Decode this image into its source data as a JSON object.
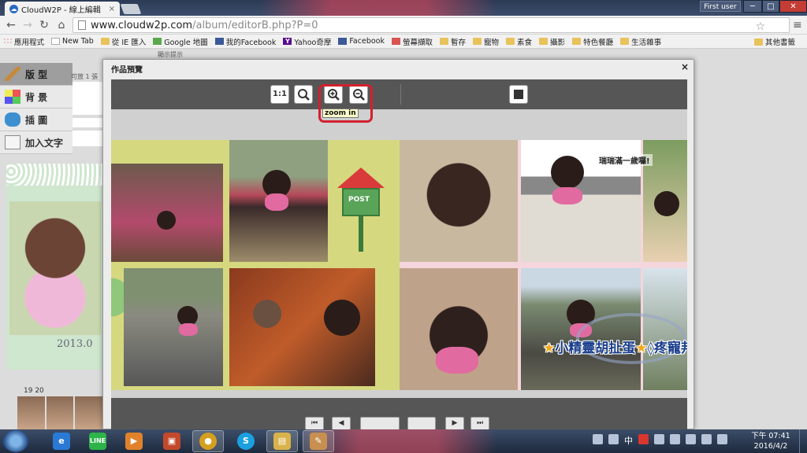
{
  "browser": {
    "tab_title": "CloudW2P - 線上編輯",
    "tab_close": "×",
    "user_badge": "First user",
    "window_controls": {
      "minimize": "─",
      "maximize": "□",
      "close": "✕"
    },
    "url_host": "www.cloudw2p.com",
    "url_path": "/album/editorB.php?P=0",
    "bookmarks": [
      {
        "label": "應用程式",
        "icon": "apps-icon"
      },
      {
        "label": "New Tab",
        "icon": "page-icon"
      },
      {
        "label": "從 IE 匯入",
        "icon": "folder-icon"
      },
      {
        "label": "Google 地圖",
        "icon": "google-maps-icon"
      },
      {
        "label": "我的Facebook",
        "icon": "facebook-icon"
      },
      {
        "label": "Yahoo奇摩",
        "icon": "yahoo-icon"
      },
      {
        "label": "Facebook",
        "icon": "facebook-icon"
      },
      {
        "label": "螢幕擷取",
        "icon": "home-icon"
      },
      {
        "label": "暫存",
        "icon": "folder-icon"
      },
      {
        "label": "寵物",
        "icon": "folder-icon"
      },
      {
        "label": "素食",
        "icon": "folder-icon"
      },
      {
        "label": "攝影",
        "icon": "folder-icon"
      },
      {
        "label": "特色餐廳",
        "icon": "folder-icon"
      },
      {
        "label": "生活雜事",
        "icon": "folder-icon"
      }
    ],
    "bookmarks_other": "其他書籤"
  },
  "editor": {
    "side_menu": [
      {
        "label": "版 型",
        "icon": "layout-icon"
      },
      {
        "label": "背 景",
        "icon": "background-icon"
      },
      {
        "label": "插 圖",
        "icon": "illustration-icon"
      },
      {
        "label": "加入文字",
        "icon": "text-icon"
      }
    ],
    "side_hint": "可放 1 張",
    "top_hint": "顯示提示",
    "card_date": "2013.0",
    "page_numbers": "19  20"
  },
  "dialog": {
    "title": "作品預覽",
    "close": "×",
    "toolbar": {
      "actual_size_label": "1:1",
      "zoom_in_tooltip": "zoom in"
    },
    "album": {
      "mailbox_label": "POST",
      "caption": "瑞瑞滿一歲囉!",
      "watermark": "小精靈胡扯蛋",
      "watermark_tail": "◊疼寵邦◊"
    },
    "highlight_color": "#d1202e"
  },
  "taskbar": {
    "apps": [
      {
        "name": "ie",
        "label": "e",
        "color": "#2a7ad5"
      },
      {
        "name": "line",
        "label": "LINE",
        "color": "#2db34a"
      },
      {
        "name": "media-player",
        "label": "▶",
        "color": "#e0822a"
      },
      {
        "name": "store",
        "label": "▣",
        "color": "#c2492c"
      },
      {
        "name": "chrome",
        "label": "●",
        "color": "#d4a020"
      },
      {
        "name": "skype",
        "label": "S",
        "color": "#1aa0e0"
      },
      {
        "name": "explorer",
        "label": "▤",
        "color": "#d9b24a"
      },
      {
        "name": "paint",
        "label": "✎",
        "color": "#c89050"
      }
    ],
    "lang": "中",
    "clock_time": "下午 07:41",
    "clock_date": "2016/4/2"
  }
}
